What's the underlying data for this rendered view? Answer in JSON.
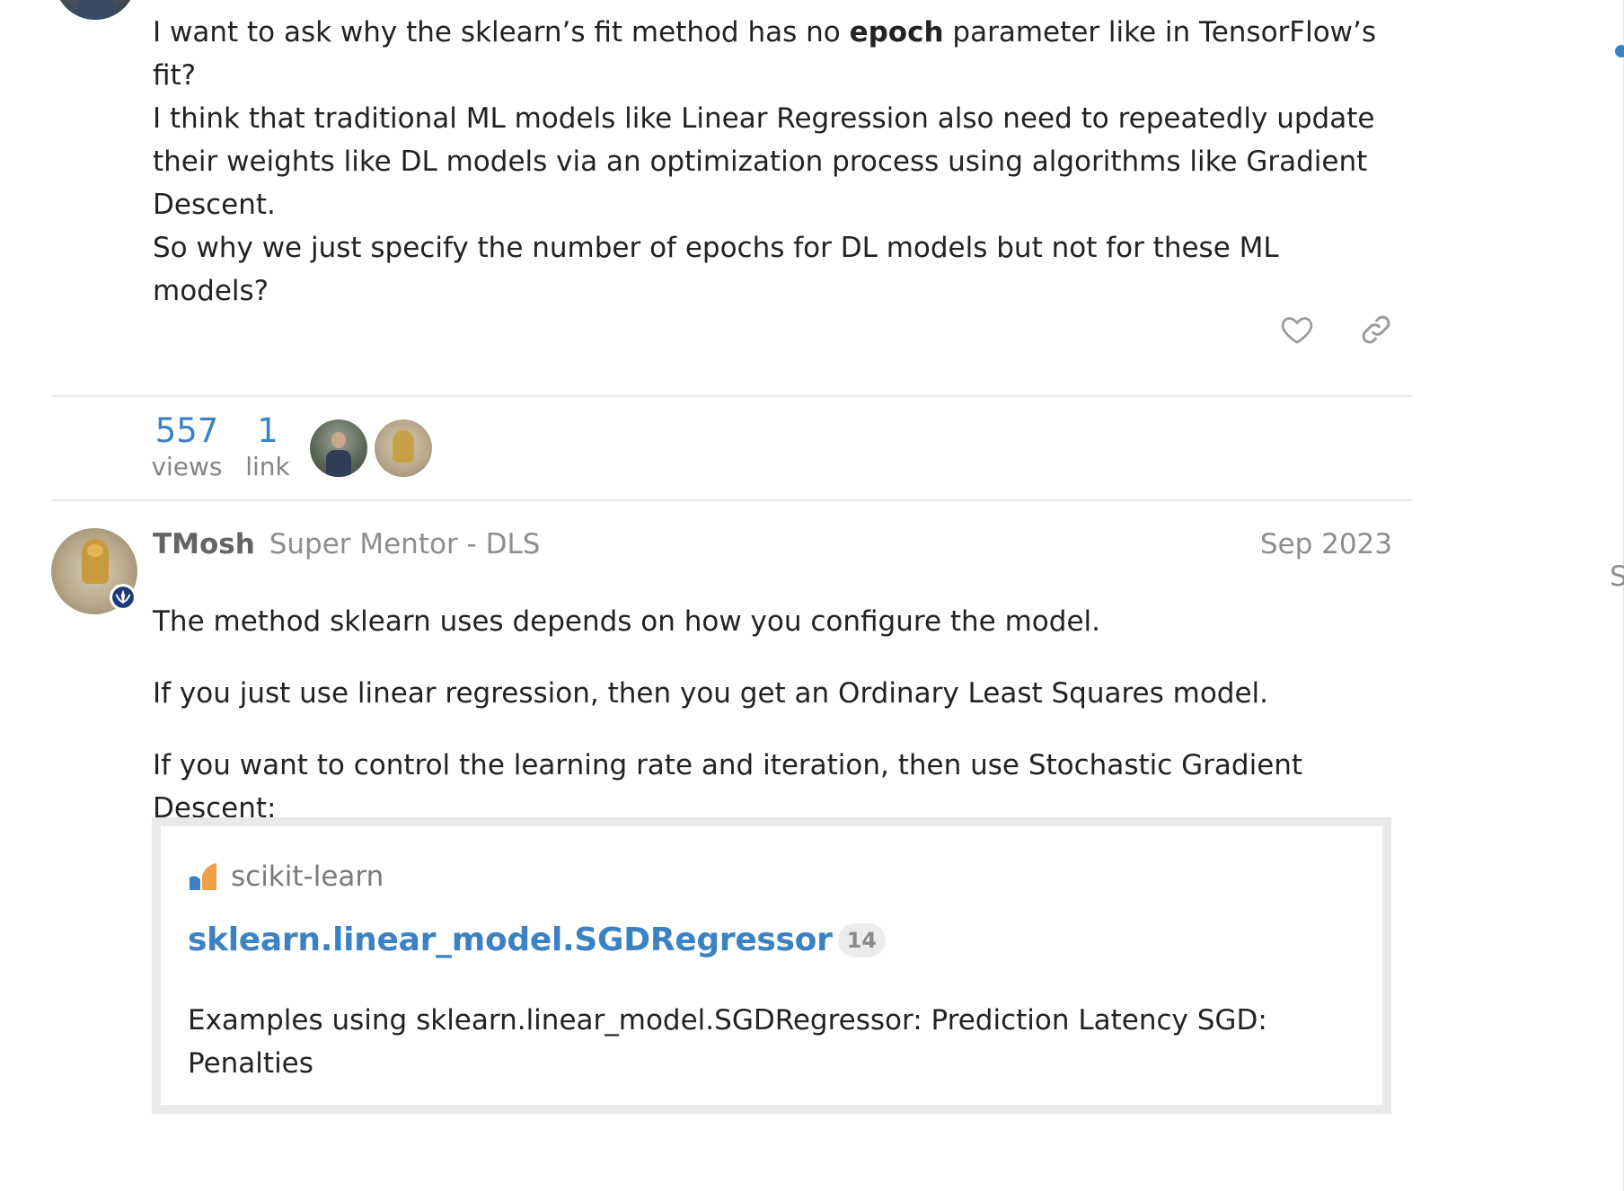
{
  "question": {
    "lines": {
      "l1_before": "I want to ask why the sklearn’s fit method has no ",
      "l1_bold": "epoch",
      "l1_after": " parameter like in TensorFlow’s fit?",
      "l2": "I think that traditional ML models like Linear Regression also need to repeatedly update their weights like DL models via an optimization process using algorithms like Gradient Descent.",
      "l3": "So why we just specify the number of epochs for DL models but not for these ML models?"
    },
    "actions": {
      "like_icon": "heart-icon",
      "link_icon": "link-icon"
    }
  },
  "topic_map": {
    "views_count": "557",
    "views_label": "views",
    "links_count": "1",
    "links_label": "link"
  },
  "reply": {
    "username": "TMosh",
    "user_title": "Super Mentor - DLS",
    "date": "Sep 2023",
    "paragraphs": [
      "The method sklearn uses depends on how you configure the model.",
      "If you just use linear regression, then you get an Ordinary Least Squares model.",
      "If you want to control the learning rate and iteration, then use Stochastic Gradient Descent:"
    ],
    "onebox": {
      "source": "scikit-learn",
      "title": "sklearn.linear_model.SGDRegressor",
      "clicks": "14",
      "description": "Examples using sklearn.linear_model.SGDRegressor: Prediction Latency SGD: Penalties"
    }
  },
  "timeline": {
    "letter": "S"
  },
  "colors": {
    "link": "#3b82c4",
    "muted": "#8d8d8d",
    "text": "#222222"
  }
}
